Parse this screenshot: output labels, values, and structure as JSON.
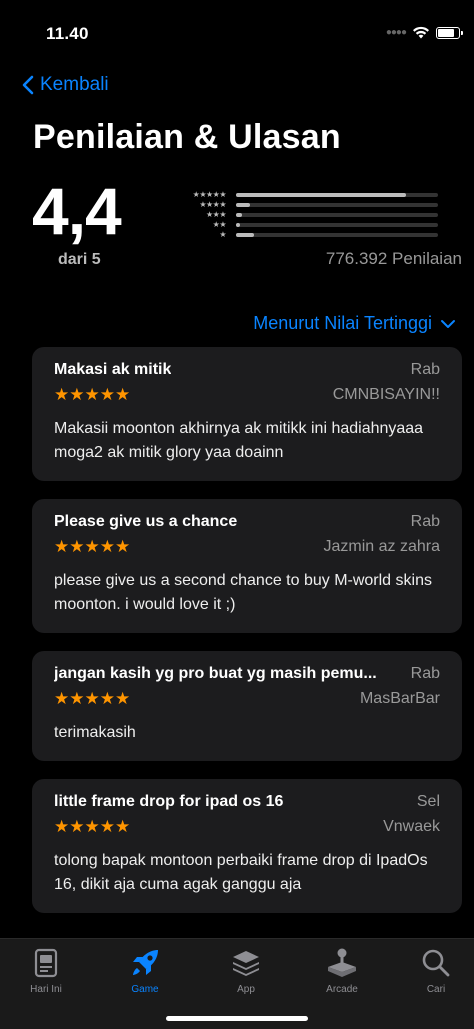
{
  "status": {
    "time": "11.40",
    "battery_level": 0.85
  },
  "nav": {
    "back_label": "Kembali"
  },
  "header": {
    "title": "Penilaian & Ulasan"
  },
  "summary": {
    "average": "4,4",
    "out_of": "dari 5",
    "count_label": "776.392 Penilaian",
    "histogram": [
      {
        "stars": "★★★★★",
        "fraction": 0.84
      },
      {
        "stars": "★★★★",
        "fraction": 0.07
      },
      {
        "stars": "★★★",
        "fraction": 0.03
      },
      {
        "stars": "★★",
        "fraction": 0.02
      },
      {
        "stars": "★",
        "fraction": 0.09
      }
    ]
  },
  "sort": {
    "label": "Menurut Nilai Tertinggi"
  },
  "reviews": [
    {
      "title": "Makasi ak mitik",
      "date": "Rab",
      "stars": "★★★★★",
      "author": "CMNBISAYIN!!",
      "body": "Makasii moonton akhirnya ak mitikk ini hadiahnyaaa moga2 ak mitik glory yaa doainn"
    },
    {
      "title": "Please give us  a chance",
      "date": "Rab",
      "stars": "★★★★★",
      "author": "Jazmin az zahra",
      "body": "please give us a second chance to buy M-world skins moonton. i would love it ;)"
    },
    {
      "title": "jangan kasih yg pro buat yg masih pemu...",
      "date": "Rab",
      "stars": "★★★★★",
      "author": "MasBarBar",
      "body": "terimakasih"
    },
    {
      "title": "little frame drop for ipad os 16",
      "date": "Sel",
      "stars": "★★★★★",
      "author": "Vnwaek",
      "body": "tolong bapak montoon perbaiki frame drop di IpadOs 16, dikit aja cuma agak ganggu aja"
    }
  ],
  "tabs": [
    {
      "label": "Hari Ini",
      "icon": "today-icon"
    },
    {
      "label": "Game",
      "icon": "rocket-icon",
      "active": true
    },
    {
      "label": "App",
      "icon": "layers-icon"
    },
    {
      "label": "Arcade",
      "icon": "joystick-icon"
    },
    {
      "label": "Cari",
      "icon": "search-icon"
    }
  ],
  "colors": {
    "accent": "#0a84ff",
    "star": "#ff9500",
    "card": "#1c1c1e",
    "background": "#000000"
  }
}
